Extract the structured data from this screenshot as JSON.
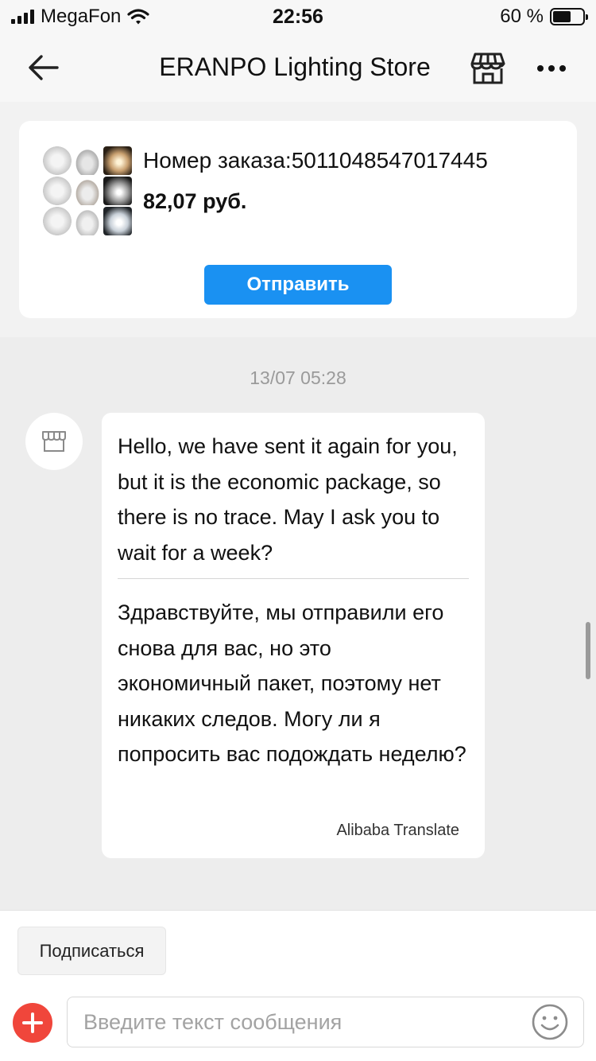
{
  "status_bar": {
    "carrier": "MegaFon",
    "time": "22:56",
    "battery_text": "60 %",
    "battery_level": 0.6
  },
  "header": {
    "title": "ERANPO Lighting Store",
    "icons": [
      "back-arrow-icon",
      "store-icon",
      "more-dots-icon"
    ]
  },
  "order_card": {
    "order_number": "Номер заказа:5011048547017445",
    "price": "82,07 руб.",
    "send_label": "Отправить"
  },
  "chat": {
    "timestamp": "13/07 05:28",
    "message_original": "Hello, we have sent it again for you, but it is the economic package, so there is no trace. May I ask you to wait for a week?",
    "message_translated": "Здравствуйте, мы отправили его снова для вас, но это экономичный пакет, поэтому нет никаких следов. Могу ли я попросить вас подождать неделю?",
    "translation_credit": "Alibaba Translate"
  },
  "bottom_bar": {
    "subscribe_label": "Подписаться",
    "input_placeholder": "Введите текст сообщения",
    "input_value": ""
  },
  "colors": {
    "accent_blue": "#1a91f2",
    "add_button_red": "#f0463b",
    "chat_background": "#ededed"
  }
}
